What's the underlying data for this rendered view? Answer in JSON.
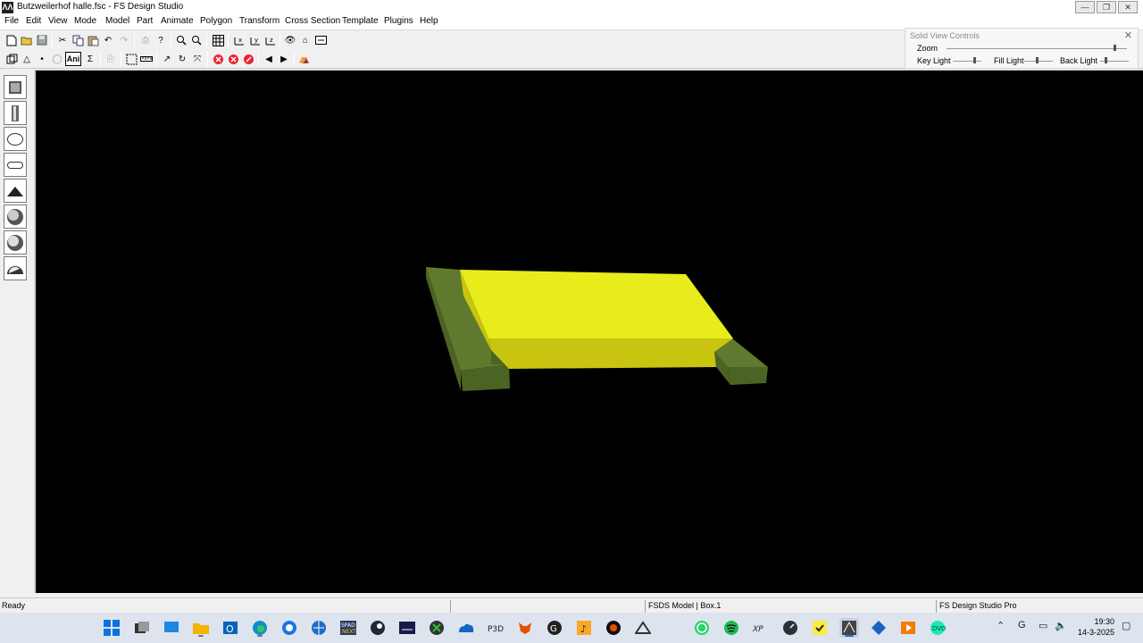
{
  "window": {
    "title": "Butzweilerhof halle.fsc - FS Design Studio",
    "app_icon": "fsds-app-icon"
  },
  "menu": [
    "File",
    "Edit",
    "View",
    "Mode",
    "Model",
    "Part",
    "Animate",
    "Polygon",
    "Transform",
    "Cross Section",
    "Template",
    "Plugins",
    "Help"
  ],
  "toolbar2": {
    "ani_label": "Ani",
    "sigma_label": "Σ"
  },
  "solid_view_controls": {
    "title": "Solid View Controls",
    "zoom_label": "Zoom",
    "key_light_label": "Key Light",
    "fill_light_label": "Fill Light",
    "back_light_label": "Back Light",
    "zoom_level": 0.93,
    "key_light_level": 0.75,
    "fill_light_level": 0.45,
    "back_light_level": 0.2
  },
  "colors": {
    "model_top": "#e8ec1a",
    "model_front": "#c9c410",
    "base_top": "#5f7a2e",
    "base_front": "#4b6323",
    "viewport_bg": "#000000"
  },
  "status": {
    "left": "Ready",
    "middle": "FSDS Model | Box.1",
    "right": "FS Design Studio Pro"
  },
  "clock": {
    "time": "19:30",
    "date": "14-3-2025"
  },
  "taskbar_icons": [
    "windows-start-icon",
    "task-view-icon",
    "display-icon",
    "file-explorer-icon",
    "outlook-icon",
    "edge-icon",
    "browser-icon",
    "world-icon",
    "spad-icon",
    "steam-icon",
    "app-icon",
    "xbox-icon",
    "cloud-icon",
    "p3d-icon",
    "fox-icon",
    "g-icon",
    "music-icon",
    "settings-icon",
    "nav-icon",
    "whatsapp-icon",
    "spotify-icon",
    "xp-icon",
    "gauge-icon",
    "checklist-icon",
    "fsds-icon",
    "diamond-icon",
    "slides-icon",
    "quick-icon"
  ]
}
